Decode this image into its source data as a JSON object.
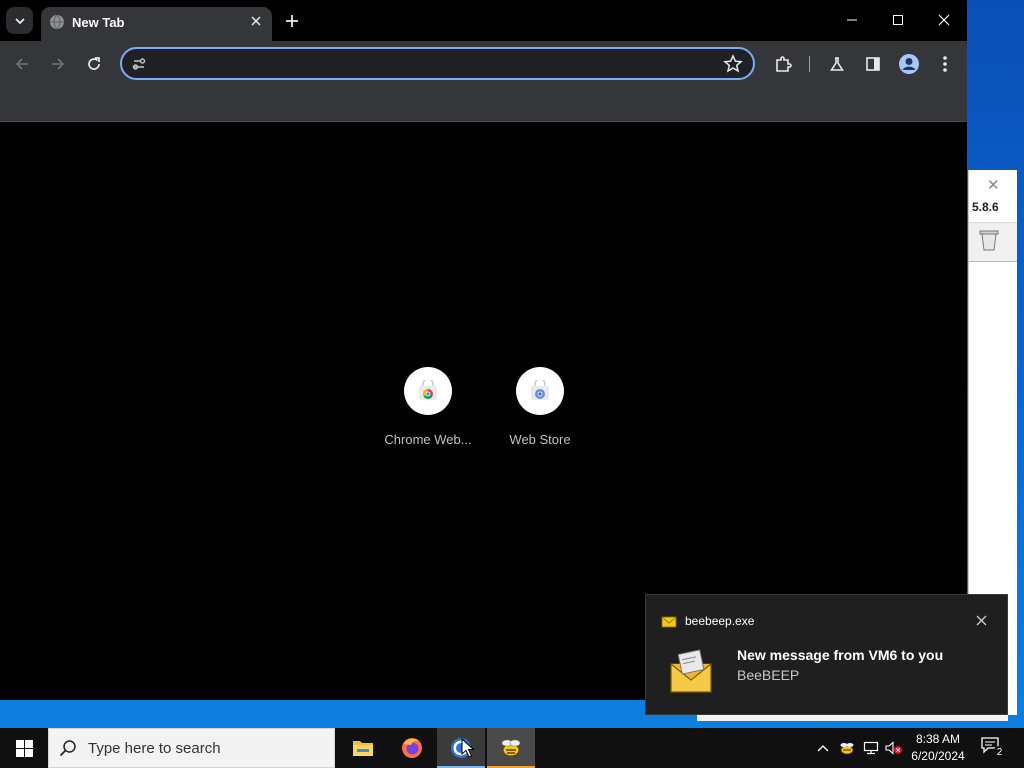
{
  "browser": {
    "tab": {
      "title": "New Tab"
    },
    "omnibox": {
      "value": "",
      "placeholder": ""
    },
    "shortcuts": [
      {
        "label": "Chrome Web..."
      },
      {
        "label": "Web Store"
      }
    ],
    "colors": {
      "frame": "#000000",
      "toolbar": "#35363a",
      "omnibox_focus": "#7cacf8"
    }
  },
  "background_window": {
    "version": "5.8.6"
  },
  "notification": {
    "app": "beebeep.exe",
    "title": "New message from VM6 to you",
    "body": "BeeBEEP"
  },
  "taskbar": {
    "search_placeholder": "Type here to search",
    "clock": {
      "time": "8:38 AM",
      "date": "6/20/2024"
    },
    "notification_count": "2",
    "apps": [
      "file-explorer-icon",
      "firefox-icon",
      "chrome-icon",
      "beebeep-icon"
    ]
  }
}
